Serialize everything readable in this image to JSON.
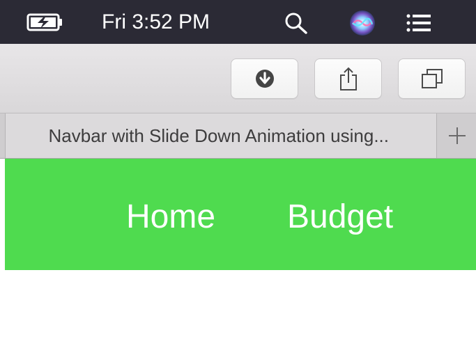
{
  "menubar": {
    "clock": "Fri 3:52 PM",
    "icons": [
      "battery-charging-icon",
      "search-icon",
      "siri-icon",
      "notification-center-icon"
    ]
  },
  "toolbar": {
    "buttons": [
      "download-icon",
      "share-icon",
      "show-tabs-icon"
    ]
  },
  "tabs": {
    "active_title": "Navbar with Slide Down Animation using...",
    "new_tab_icon": "plus-icon"
  },
  "page": {
    "navbar_color": "#4fdb4f",
    "nav_links": [
      "Home",
      "Budget"
    ]
  },
  "colors": {
    "menubar_bg": "#2b2a35",
    "navbar_bg": "#4fdb4f",
    "nav_text": "#ffffff"
  }
}
